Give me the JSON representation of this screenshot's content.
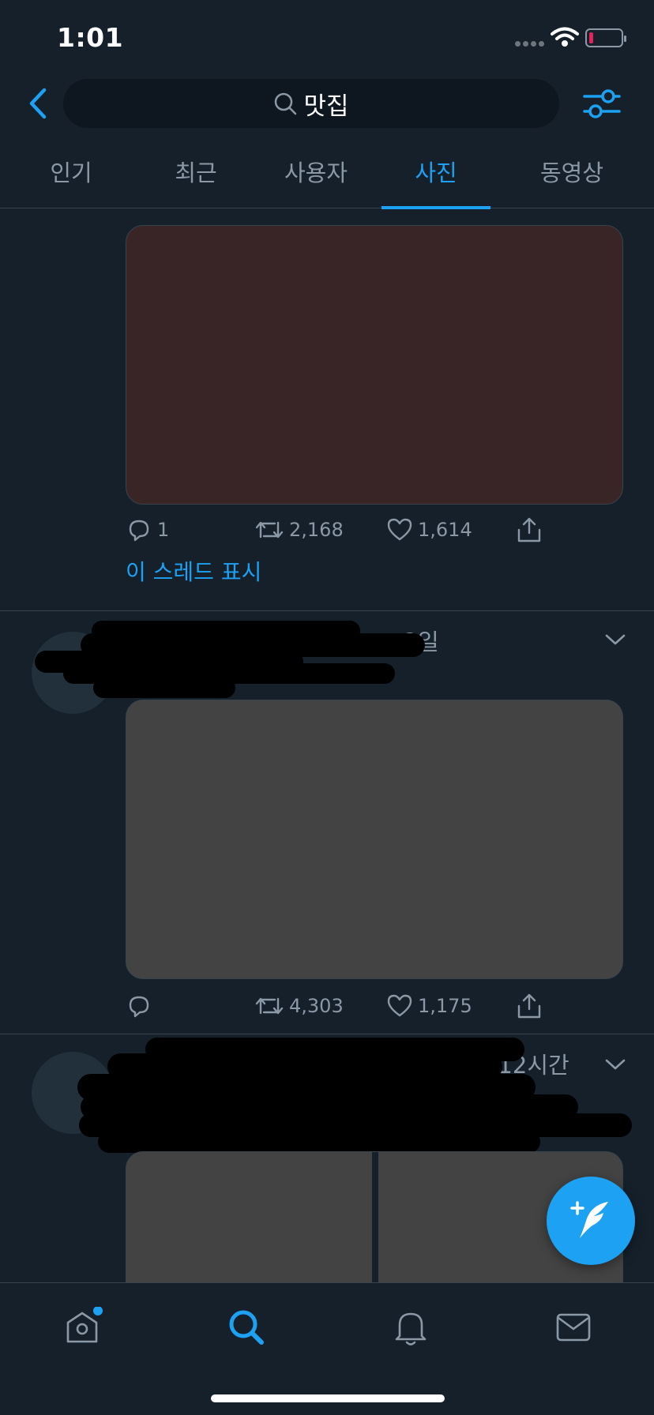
{
  "status_bar": {
    "time": "1:01"
  },
  "search": {
    "query": "맛집"
  },
  "tabs": [
    {
      "label": "인기"
    },
    {
      "label": "최근"
    },
    {
      "label": "사용자"
    },
    {
      "label": "사진",
      "active": true
    },
    {
      "label": "동영상"
    }
  ],
  "tweets": [
    {
      "media_color": "#3a2526",
      "replies": "1",
      "retweets": "2,168",
      "likes": "1,614",
      "thread_link": "이 스레드 표시"
    },
    {
      "meta_visible": "se · 2일",
      "media_color": "#434343",
      "replies": "",
      "retweets": "4,303",
      "likes": "1,175"
    },
    {
      "meta_visible": "· 12시간",
      "media_color": "#434343"
    }
  ],
  "colors": {
    "accent": "#1da1f2",
    "background": "#15202b",
    "muted": "#8b98a5",
    "divider": "#38444d"
  },
  "icons": {
    "back": "chevron-left-icon",
    "search": "search-icon",
    "filter": "sliders-icon",
    "reply": "reply-icon",
    "retweet": "retweet-icon",
    "like": "heart-icon",
    "share": "share-icon",
    "compose": "compose-tweet-icon",
    "home": "home-icon",
    "explore": "search-icon",
    "notifications": "bell-icon",
    "messages": "mail-icon"
  }
}
